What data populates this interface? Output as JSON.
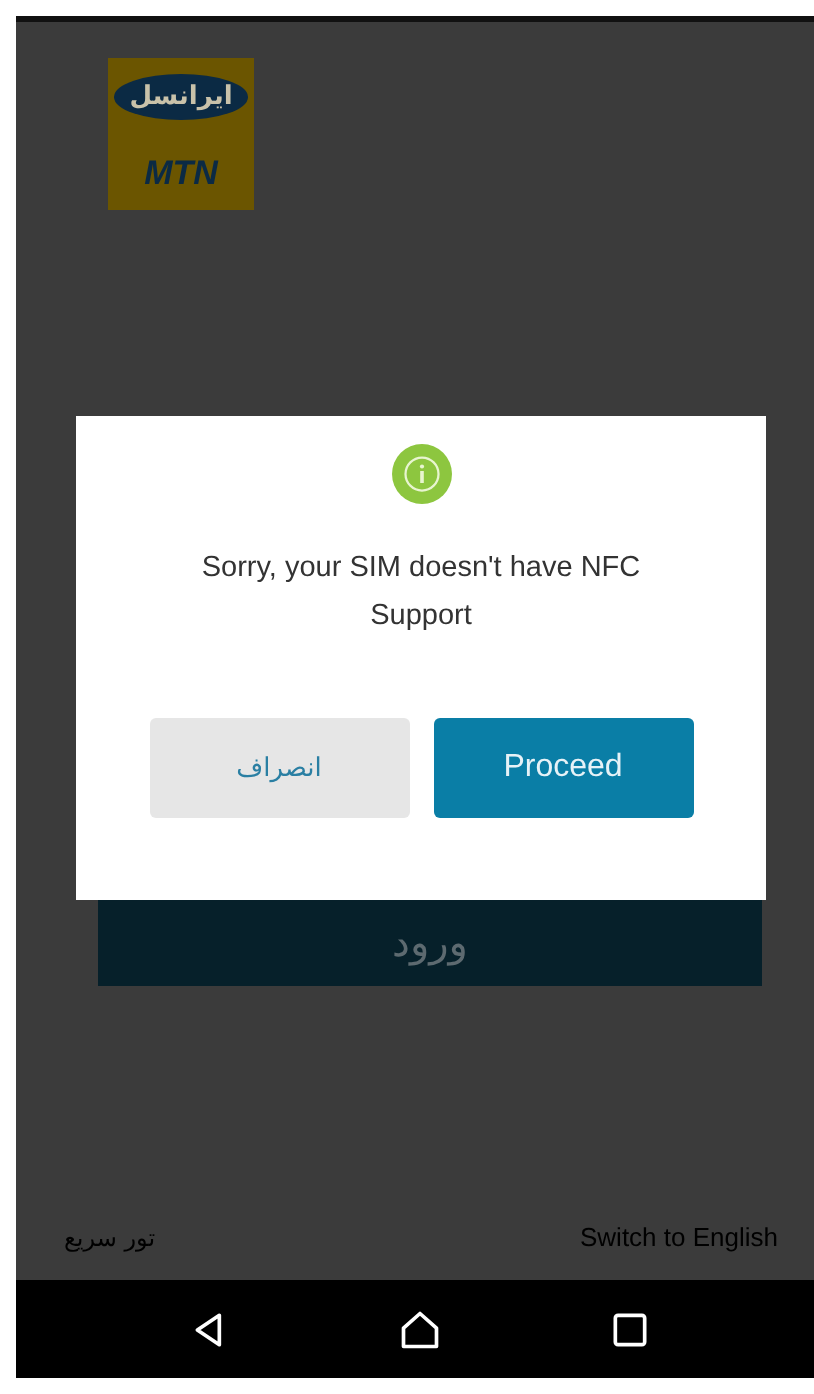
{
  "logo": {
    "brand_text": "ایرانسل",
    "sub_text": "MTN"
  },
  "login_button": {
    "label": "ورود"
  },
  "footer": {
    "left_link": "تور سریع",
    "right_link": "Switch to English"
  },
  "dialog": {
    "message": "Sorry, your SIM doesn't have NFC Support",
    "buttons": [
      {
        "label": "Proceed",
        "kind": "primary"
      },
      {
        "label": "انصراف",
        "kind": "secondary"
      }
    ]
  },
  "nav_bar": {
    "buttons": [
      {
        "kind": "back"
      },
      {
        "kind": "home"
      },
      {
        "kind": "recents"
      }
    ]
  }
}
